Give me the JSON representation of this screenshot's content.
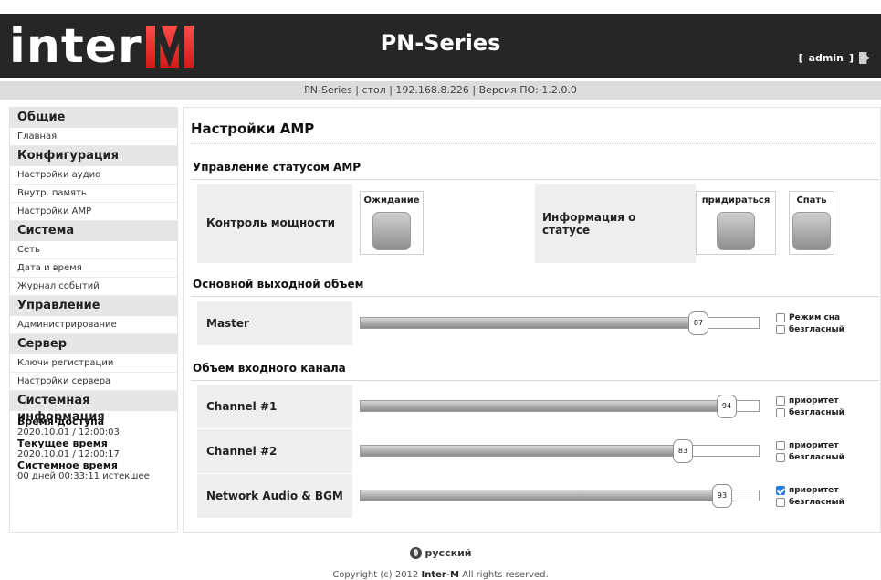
{
  "header": {
    "logo_text": "inter",
    "logo_letter": "M",
    "product_title": "PN-Series",
    "user_bracket_open": "[",
    "user_name": "admin",
    "user_bracket_close": "]"
  },
  "status_bar": {
    "text": "PN-Series | стол | 192.168.8.226 | Версия ПО: 1.2.0.0"
  },
  "sidebar": {
    "groups": [
      {
        "title": "Общие",
        "items": [
          "Главная"
        ]
      },
      {
        "title": "Конфигурация",
        "items": [
          "Настройки аудио",
          "Внутр. память",
          "Настройки AMP"
        ]
      },
      {
        "title": "Система",
        "items": [
          "Сеть",
          "Дата и время",
          "Журнал событий"
        ]
      },
      {
        "title": "Управление",
        "items": [
          "Администрирование"
        ]
      },
      {
        "title": "Сервер",
        "items": [
          "Ключи регистрации",
          "Настройки сервера"
        ]
      }
    ],
    "sysinfo": {
      "title": "Системная информация",
      "access_label": "Время доступа",
      "access_value": "2020.10.01 / 12:00:03",
      "current_label": "Текущее время",
      "current_value": "2020.10.01 / 12:00:17",
      "system_label": "Системное время",
      "system_value": "00 дней 00:33:11 истекшее"
    }
  },
  "main": {
    "page_title": "Настройки AMP",
    "amp_status": {
      "section_title": "Управление статусом AMP",
      "power_label": "Контроль мощности",
      "standby_label": "Ожидание",
      "status_label": "Информация о статусе",
      "fault_label": "придираться",
      "sleep_label": "Спать"
    },
    "master": {
      "section_title": "Основной выходной объем",
      "label": "Master",
      "value": 87,
      "value_text": "87",
      "check1": "Режим сна",
      "check1_checked": false,
      "check2": "безгласный",
      "check2_checked": false
    },
    "input": {
      "section_title": "Объем входного канала",
      "channels": [
        {
          "label": "Channel #1",
          "value": 94,
          "value_text": "94",
          "priority": "приоритет",
          "priority_checked": false,
          "mute": "безгласный",
          "mute_checked": false
        },
        {
          "label": "Channel #2",
          "value": 83,
          "value_text": "83",
          "priority": "приоритет",
          "priority_checked": false,
          "mute": "безгласный",
          "mute_checked": false
        },
        {
          "label": "Network Audio & BGM",
          "value": 93,
          "value_text": "93",
          "priority": "приоритет",
          "priority_checked": true,
          "mute": "безгласный",
          "mute_checked": false
        }
      ]
    }
  },
  "footer": {
    "language": "русский",
    "copyright_prefix": "Copyright (c) 2012",
    "copyright_brand": "Inter-M",
    "copyright_suffix": "All rights reserved."
  }
}
